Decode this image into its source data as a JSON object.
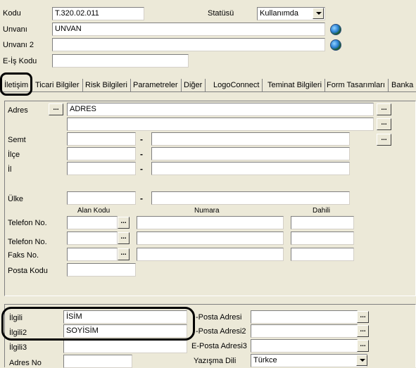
{
  "header": {
    "code_label": "Kodu",
    "code_value": "T.320.02.011",
    "status_label": "Statüsü",
    "status_value": "Kullanımda",
    "title_label": "Unvanı",
    "title_value": "UNVAN",
    "title2_label": "Unvanı 2",
    "title2_value": "",
    "ebiz_label": "E-İş Kodu",
    "ebiz_value": ""
  },
  "tabs": [
    "İletişim",
    "Ticari Bilgiler",
    "Risk Bilgileri",
    "Parametreler",
    "Diğer",
    "LogoConnect",
    "Teminat Bilgileri",
    "Form Tasarımları",
    "Banka I"
  ],
  "contact": {
    "address_label": "Adres",
    "address_line1": "ADRES",
    "address_line2": "",
    "district_label": "Semt",
    "county_label": "İlçe",
    "city_label": "İl",
    "country_label": "Ülke",
    "col_area": "Alan Kodu",
    "col_number": "Numara",
    "col_ext": "Dahili",
    "phone1_label": "Telefon No.",
    "phone2_label": "Telefon No.",
    "fax_label": "Faks No.",
    "postal_label": "Posta Kodu",
    "dash": "-",
    "ellipsis": "..."
  },
  "contact_persons": {
    "person1_label": "İlgili",
    "person1_value": "İSİM",
    "person2_label": "İlgili2",
    "person2_value": "SOYİSİM",
    "person3_label": "İlgili3",
    "person3_value": "",
    "address_no_label": "Adres No",
    "email1_label": "-Posta Adresi",
    "email2_label": "-Posta Adresi2",
    "email3_label": "E-Posta Adresi3",
    "language_label": "Yazışma Dili",
    "language_value": "Türkce"
  },
  "colors": {
    "background": "#ece9d8",
    "highlight_outline": "#000000"
  }
}
